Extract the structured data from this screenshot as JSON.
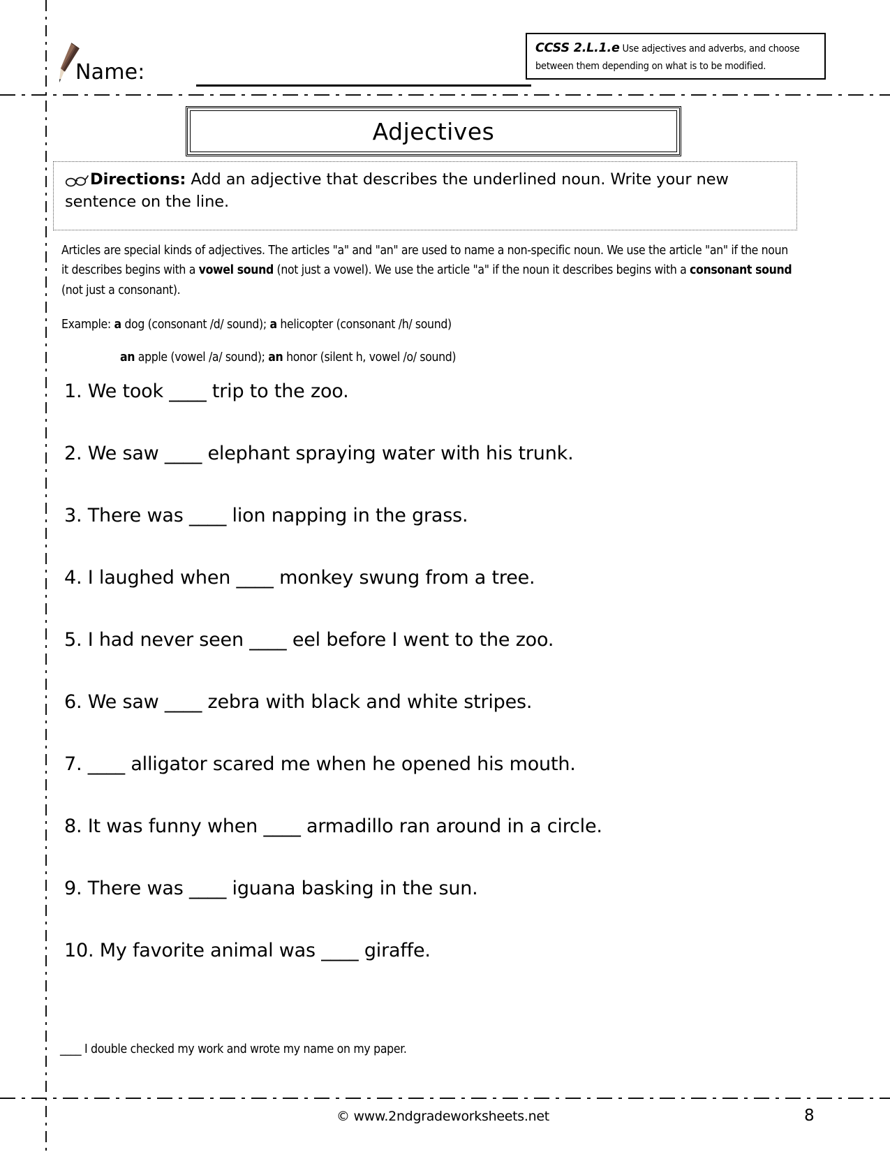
{
  "header": {
    "pencil_icon": "pencil-icon",
    "name_label": "Name:",
    "ccss": {
      "code": "CCSS 2.L.1.e",
      "text": " Use adjectives and adverbs, and choose between them depending on what is to be modified."
    }
  },
  "title": "Adjectives",
  "directions": {
    "glasses_icon": "glasses-icon",
    "lead": "Directions:",
    "body": " Add an adjective that describes the underlined noun.  Write your new sentence on the line."
  },
  "explanation": {
    "part1": "Articles are special kinds of adjectives.  The articles \"a\" and \"an\" are used to name a non-specific noun.  We use the article \"an\" if the noun it describes begins with a ",
    "bold1": "vowel sound",
    "part2": " (not just a vowel).  We use the article \"a\" if the noun it describes begins with a ",
    "bold2": "consonant sound",
    "part3": " (not just a consonant)."
  },
  "examples": {
    "line1_prefix": "Example: ",
    "line1_b1": "a",
    "line1_mid1": " dog (consonant /d/ sound); ",
    "line1_b2": "a",
    "line1_mid2": " helicopter (consonant /h/ sound)",
    "line2_b1": "an",
    "line2_mid1": " apple (vowel /a/ sound); ",
    "line2_b2": "an",
    "line2_mid2": " honor (silent h, vowel /o/ sound)"
  },
  "questions": [
    "1.  We took ____ trip to the zoo.",
    "2. We saw ____ elephant spraying water with his trunk.",
    "3. There was ____ lion napping in the grass.",
    "4.  I laughed when ____ monkey swung from a tree.",
    "5. I had never seen ____ eel before I went to the zoo.",
    "6. We saw ____ zebra with black and white stripes.",
    "7. ____ alligator scared me when he opened his mouth.",
    "8. It was funny when ____ armadillo ran around in a circle.",
    "9.  There was ____ iguana basking in the sun.",
    "10.  My favorite animal was ____ giraffe."
  ],
  "checklist": "____ I double checked my work and wrote my name on my  paper.",
  "footer": {
    "credit": "© www.2ndgradeworksheets.net",
    "page_number": "8"
  }
}
